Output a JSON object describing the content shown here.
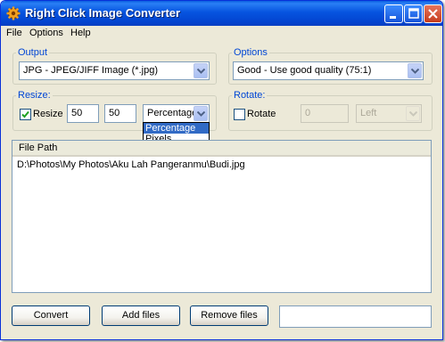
{
  "window": {
    "title": "Right Click Image Converter",
    "icon": "gear-icon"
  },
  "menu": {
    "items": [
      "File",
      "Options",
      "Help"
    ]
  },
  "output": {
    "label": "Output",
    "value": "JPG - JPEG/JIFF Image (*.jpg)"
  },
  "options": {
    "label": "Options",
    "value": "Good - Use good quality (75:1)"
  },
  "resize": {
    "label": "Resize:",
    "checkbox_label": "Resize",
    "checked": true,
    "width": "50",
    "height": "50",
    "unit": "Percentage",
    "unit_options": [
      "Percentage",
      "Pixels"
    ]
  },
  "rotate": {
    "label": "Rotate:",
    "checkbox_label": "Rotate",
    "checked": false,
    "angle": "0",
    "direction": "Left"
  },
  "file_list": {
    "columns": [
      "File Path"
    ],
    "rows": [
      "D:\\Photos\\My Photos\\Aku Lah Pangeranmu\\Budi.jpg"
    ]
  },
  "buttons": {
    "convert": "Convert",
    "add_files": "Add files",
    "remove_files": "Remove files"
  },
  "status": {
    "text": ""
  },
  "colors": {
    "title_bar": "#0654e0",
    "group_label": "#0046d5",
    "selection": "#316ac5"
  }
}
